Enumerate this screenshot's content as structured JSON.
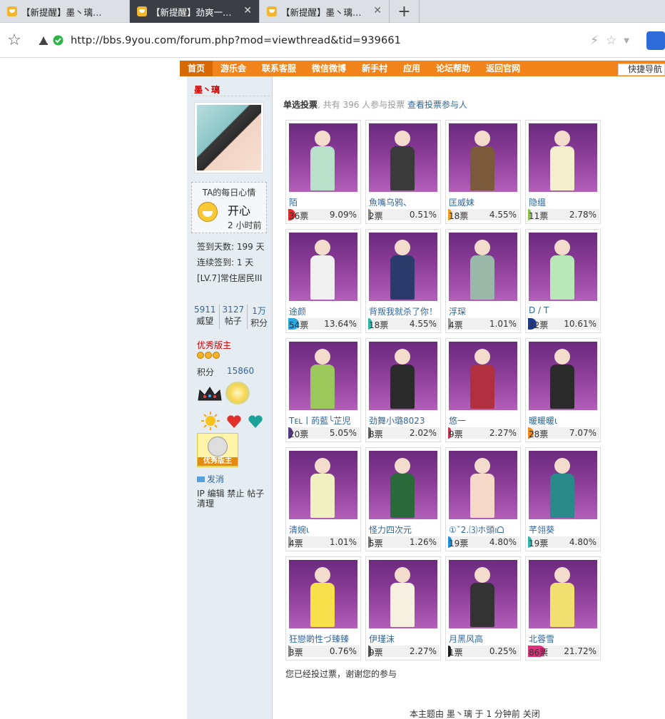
{
  "browser": {
    "tabs": [
      {
        "title": "【新提醒】墨丶璃的帖..."
      },
      {
        "title": "【新提醒】劲爽一夏，..."
      },
      {
        "title": "【新提醒】墨丶璃的帖..."
      }
    ],
    "new_tab": "+",
    "url": "http://bbs.9you.com/forum.php?mod=viewthread&tid=939661"
  },
  "nav": {
    "items": [
      "首页",
      "游乐会",
      "联系客服",
      "微信微博",
      "新手村",
      "应用",
      "论坛帮助",
      "返回官网"
    ],
    "quick": "快捷导航"
  },
  "profile": {
    "author": "墨丶璃",
    "mood_title": "TA的每日心情",
    "mood": "开心",
    "mood_time": "2 小时前",
    "signin_days": "签到天数: 199 天",
    "consecutive": "连续签到: 1 天",
    "level": "[LV.7]常住居民III",
    "counts": [
      {
        "num": "5911",
        "label": "威望"
      },
      {
        "num": "3127",
        "label": "帖子"
      },
      {
        "num": "1万",
        "label": "积分"
      }
    ],
    "group": "优秀版主",
    "score_label": "积分",
    "score": "15860",
    "badge_label": "优秀版主",
    "message": "发消",
    "admin": "IP 编辑 禁止 帖子 清理"
  },
  "poll": {
    "type": "单选投票",
    "count_text": ", 共有 396 人参与投票 ",
    "view_link": "查看投票参与人",
    "voted_msg": "您已经投过票，谢谢您的参与",
    "closed": "本主题由 墨丶璃 于 1 分钟前 关闭",
    "options": [
      {
        "name": "陌",
        "votes": "36票",
        "pct": "9.09%",
        "value": 9.09,
        "color": "#e32a2a"
      },
      {
        "name": "魚嘴乌鸦、",
        "votes": "2票",
        "pct": "0.51%",
        "value": 0.51,
        "color": "#8a8a8a"
      },
      {
        "name": "匡威妹",
        "votes": "18票",
        "pct": "4.55%",
        "value": 4.55,
        "color": "#f29b1c"
      },
      {
        "name": "隐缊",
        "votes": "11票",
        "pct": "2.78%",
        "value": 2.78,
        "color": "#8bc34a"
      },
      {
        "name": "途颜",
        "votes": "54票",
        "pct": "13.64%",
        "value": 13.64,
        "color": "#29a8e0"
      },
      {
        "name": "背叛我就杀了你！",
        "votes": "18票",
        "pct": "4.55%",
        "value": 4.55,
        "color": "#2fb8a8"
      },
      {
        "name": "浮琛",
        "votes": "4票",
        "pct": "1.01%",
        "value": 1.01,
        "color": "#9a9a9a"
      },
      {
        "name": "D / T",
        "votes": "42票",
        "pct": "10.61%",
        "value": 10.61,
        "color": "#1f3b8f"
      },
      {
        "name": "Tᴇʟ丨菂藍╰芷児",
        "votes": "20票",
        "pct": "5.05%",
        "value": 5.05,
        "color": "#5b3a8c"
      },
      {
        "name": "劲舞小璐8023",
        "votes": "8票",
        "pct": "2.02%",
        "value": 2.02,
        "color": "#666666"
      },
      {
        "name": "悠一",
        "votes": "9票",
        "pct": "2.27%",
        "value": 2.27,
        "color": "#d0304c"
      },
      {
        "name": "暖暖暖ι",
        "votes": "28票",
        "pct": "7.07%",
        "value": 7.07,
        "color": "#f08a1a"
      },
      {
        "name": "清婉ι",
        "votes": "4票",
        "pct": "1.01%",
        "value": 1.01,
        "color": "#9a9a9a"
      },
      {
        "name": "怪力四次元",
        "votes": "5票",
        "pct": "1.26%",
        "value": 1.26,
        "color": "#7a7a7a"
      },
      {
        "name": "①ˇ2.⑶ホ頭ıᗝ",
        "votes": "19票",
        "pct": "4.80%",
        "value": 4.8,
        "color": "#1f8fd8"
      },
      {
        "name": "芊翎葵",
        "votes": "19票",
        "pct": "4.80%",
        "value": 4.8,
        "color": "#2fb8a8"
      },
      {
        "name": "狂戀啲性づ臻臻",
        "votes": "3票",
        "pct": "0.76%",
        "value": 0.76,
        "color": "#8a8a8a"
      },
      {
        "name": "伊瑾沫",
        "votes": "9票",
        "pct": "2.27%",
        "value": 2.27,
        "color": "#555555"
      },
      {
        "name": "月黑风高",
        "votes": "1票",
        "pct": "0.25%",
        "value": 0.25,
        "color": "#1a1a1a"
      },
      {
        "name": "北蓉雪",
        "votes": "86票",
        "pct": "21.72%",
        "value": 21.72,
        "color": "#e0307a"
      }
    ]
  }
}
